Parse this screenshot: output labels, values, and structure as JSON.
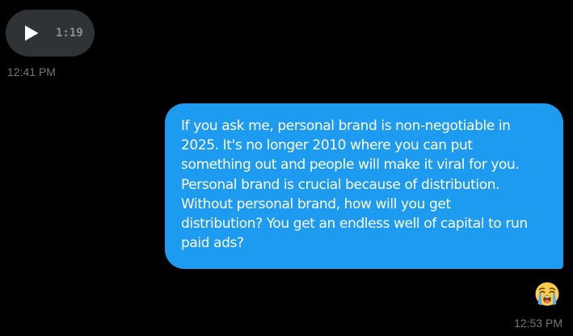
{
  "voice_message": {
    "duration": "1:19",
    "play_icon": "play-icon",
    "timestamp": "12:41 PM"
  },
  "sent_message": {
    "lines": [
      "If you ask me, personal brand is non-negotiable in",
      "2025. It's no longer 2010 where you can put",
      "something out and people will make it viral for you.",
      "Personal brand is crucial because of distribution.",
      "Without personal brand, how will you get",
      "distribution? You get an endless well of capital to run",
      "paid ads?"
    ],
    "reaction_icon": "loudly-crying-face-icon",
    "timestamp": "12:53 PM"
  },
  "colors": {
    "background": "#000000",
    "bubble_sent": "#1d9bf0",
    "voice_pill": "#2f3336",
    "timestamp": "#71767b"
  }
}
